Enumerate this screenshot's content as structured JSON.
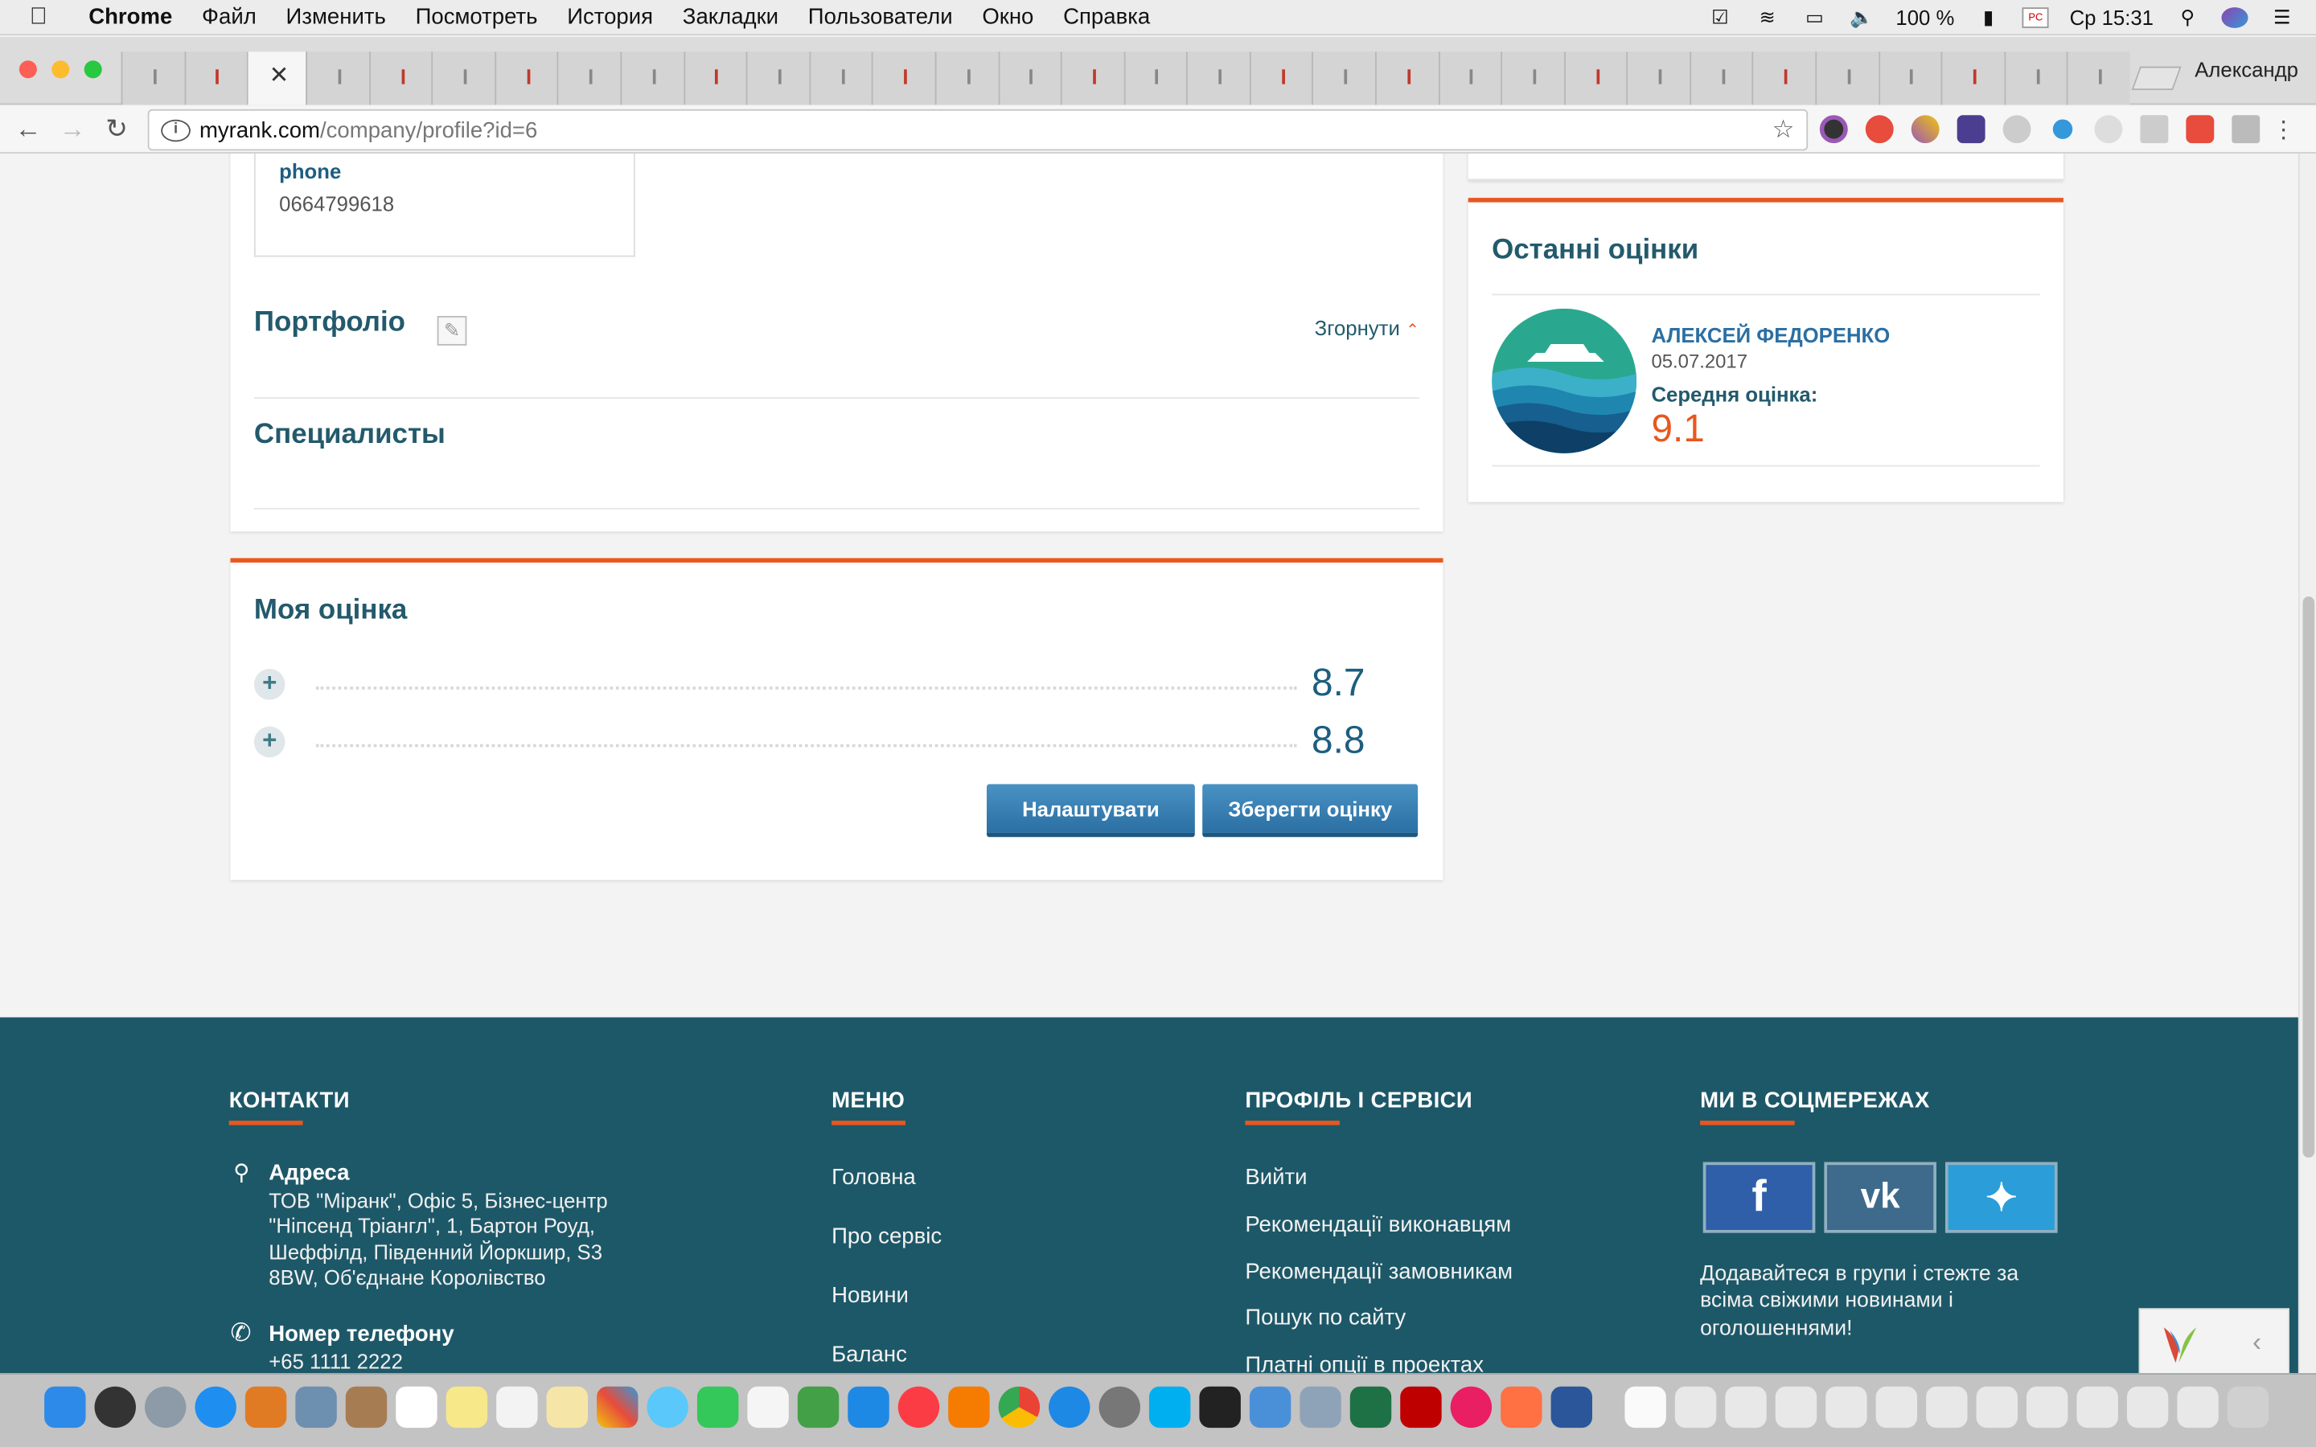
{
  "menubar": {
    "app_name": "Chrome",
    "items": [
      "Файл",
      "Изменить",
      "Посмотреть",
      "История",
      "Закладки",
      "Пользователи",
      "Окно",
      "Справка"
    ],
    "battery": "100 %",
    "clock": "Ср 15:31"
  },
  "browser": {
    "profile_name": "Александр",
    "url_host": "myrank.com",
    "url_path": "/company/profile?id=6"
  },
  "profile": {
    "contact_label": "phone",
    "contact_value": "0664799618",
    "portfolio_title": "Портфоліо",
    "collapse_label": "Згорнути",
    "specialists_title": "Специалисты"
  },
  "my_rating": {
    "title": "Моя оцінка",
    "rows": [
      {
        "value": "8.7"
      },
      {
        "value": "8.8"
      }
    ],
    "configure_label": "Налаштувати",
    "save_label": "Зберегти оцінку"
  },
  "recent_ratings": {
    "title": "Останні оцінки",
    "entries": [
      {
        "name": "АЛЕКСЕЙ ФЕДОРЕНКО",
        "date": "05.07.2017",
        "avg_label": "Середня оцінка:",
        "avg_value": "9.1"
      }
    ]
  },
  "footer": {
    "contacts": {
      "heading": "КОНТАКТИ",
      "address_label": "Адреса",
      "address_lines": [
        "ТОВ \"Міранк\", Офіс 5, Бізнес-центр",
        "\"Ніпсенд Тріангл\", 1, Бартон Роуд,",
        "Шеффілд, Південний Йоркшир, S3",
        "8BW, Об'єднане Королівство"
      ],
      "phone_label": "Номер телефону",
      "phone_value": "+65 1111 2222"
    },
    "menu": {
      "heading": "МЕНЮ",
      "links": [
        "Головна",
        "Про сервіс",
        "Новини",
        "Баланс"
      ]
    },
    "services": {
      "heading": "ПРОФІЛЬ І СЕРВІСИ",
      "links": [
        "Вийти",
        "Рекомендації виконавцям",
        "Рекомендації замовникам",
        "Пошук по сайту",
        "Платні опції в проектах"
      ]
    },
    "social": {
      "heading": "МИ В СОЦМЕРЕЖАХ",
      "text_lines": [
        "Додавайтеся в групи і стежте за",
        "всіма свіжими новинами і",
        "оголошеннями!"
      ]
    }
  },
  "colors": {
    "accent": "#e8571e",
    "primary_text": "#235a6c",
    "footer_bg": "#1d5868",
    "button": "#2b6fa3"
  }
}
